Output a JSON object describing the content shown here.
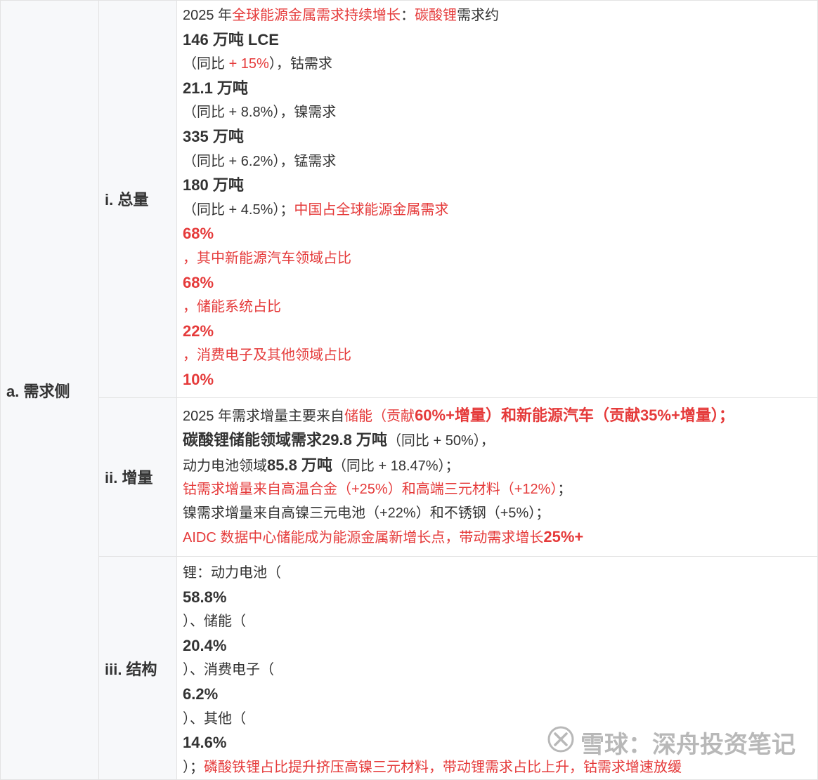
{
  "rows": [
    {
      "section": "a. 需求侧",
      "sub": "i. 总量",
      "lines": [
        [
          {
            "t": "2025 年"
          },
          {
            "t": "全球能源金属需求持续增长",
            "s": "red"
          },
          {
            "t": "："
          },
          {
            "t": "碳酸锂",
            "s": "red"
          },
          {
            "t": "需求约"
          }
        ],
        [
          {
            "t": "146 万吨 LCE",
            "s": "b"
          }
        ],
        [
          {
            "t": "（同比 "
          },
          {
            "t": "+ 15%",
            "s": "red"
          },
          {
            "t": "），钴需求"
          }
        ],
        [
          {
            "t": "21.1 万吨",
            "s": "b"
          }
        ],
        [
          {
            "t": "（同比 + 8.8%），镍需求"
          }
        ],
        [
          {
            "t": "335 万吨",
            "s": "b"
          }
        ],
        [
          {
            "t": "（同比 + 6.2%），锰需求"
          }
        ],
        [
          {
            "t": "180 万吨",
            "s": "b"
          }
        ],
        [
          {
            "t": "（同比 + 4.5%）；"
          },
          {
            "t": "中国占全球能源金属需求",
            "s": "red"
          }
        ],
        [
          {
            "t": "68%",
            "s": "rb"
          }
        ],
        [
          {
            "t": "，其中新能源汽车领域占比",
            "s": "red"
          }
        ],
        [
          {
            "t": "68%",
            "s": "rb"
          }
        ],
        [
          {
            "t": "，储能系统占比",
            "s": "red"
          }
        ],
        [
          {
            "t": "22%",
            "s": "rb"
          }
        ],
        [
          {
            "t": "，消费电子及其他领域占比",
            "s": "red"
          }
        ],
        [
          {
            "t": "10%",
            "s": "rb"
          }
        ]
      ]
    },
    {
      "section": "",
      "sub": "ii. 增量",
      "lines": [
        [
          {
            "t": "2025 年需求增量主要来自"
          },
          {
            "t": "储能（贡献",
            "s": "red"
          },
          {
            "t": "60%+增量）和新能源汽车（贡献35%+增量）；",
            "s": "rb"
          }
        ],
        [
          {
            "t": "碳酸锂储能领域需求29.8 万吨",
            "s": "b"
          },
          {
            "t": "（同比 + 50%），"
          }
        ],
        [
          {
            "t": "动力电池领域"
          },
          {
            "t": "85.8 万吨",
            "s": "b"
          },
          {
            "t": "（同比 + 18.47%）；"
          }
        ],
        [
          {
            "t": "钴需求增量来自高温合金（+25%）和高端三元材料（+12%）",
            "s": "red"
          },
          {
            "t": "；"
          }
        ],
        [
          {
            "t": "镍需求增量来自高镍三元电池（+22%）和不锈钢（+5%）；"
          }
        ],
        [
          {
            "t": "AIDC 数据中心储能成为能源金属新增长点，带动需求增长",
            "s": "red"
          },
          {
            "t": "25%+",
            "s": "rb"
          }
        ]
      ]
    },
    {
      "section": "",
      "sub": "iii. 结构",
      "lines": [
        [
          {
            "t": "锂：动力电池（"
          }
        ],
        [
          {
            "t": "58.8%",
            "s": "b"
          }
        ],
        [
          {
            "t": "）、储能（"
          }
        ],
        [
          {
            "t": "20.4%",
            "s": "b"
          }
        ],
        [
          {
            "t": "）、消费电子（"
          }
        ],
        [
          {
            "t": "6.2%",
            "s": "b"
          }
        ],
        [
          {
            "t": "）、其他（"
          }
        ],
        [
          {
            "t": "14.6%",
            "s": "b"
          }
        ],
        [
          {
            "t": "）；"
          },
          {
            "t": "磷酸铁锂占比提升挤压高镍三元材料，带动锂需求占比上升，钴需求增速放缓",
            "s": "red"
          }
        ]
      ]
    }
  ],
  "watermark": {
    "text": "雪球：深舟投资笔记",
    "icon": "xueqiu-logo-icon"
  }
}
